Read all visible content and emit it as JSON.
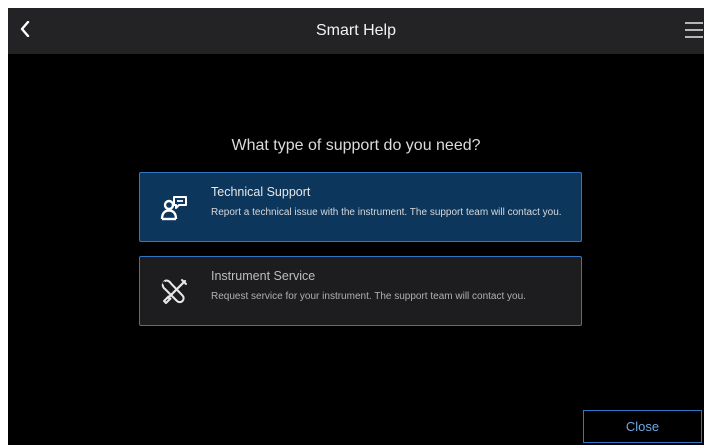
{
  "header": {
    "title": "Smart Help",
    "back_icon": "chevron-left-icon",
    "menu_icon": "hamburger-menu-icon"
  },
  "main": {
    "question": "What type of support do you need?",
    "options": [
      {
        "title": "Technical Support",
        "description": "Report a technical issue with the instrument. The support team will contact you.",
        "icon": "person-chat-icon",
        "selected": true
      },
      {
        "title": "Instrument Service",
        "description": "Request service for your instrument. The support team will contact you.",
        "icon": "wrench-screwdriver-icon",
        "selected": false
      }
    ]
  },
  "footer": {
    "close_label": "Close"
  },
  "colors": {
    "background": "#000000",
    "topbar": "#232326",
    "accent_border": "#2f77c6",
    "selected_fill": "#0c365c",
    "close_text": "#6fa8e6"
  }
}
